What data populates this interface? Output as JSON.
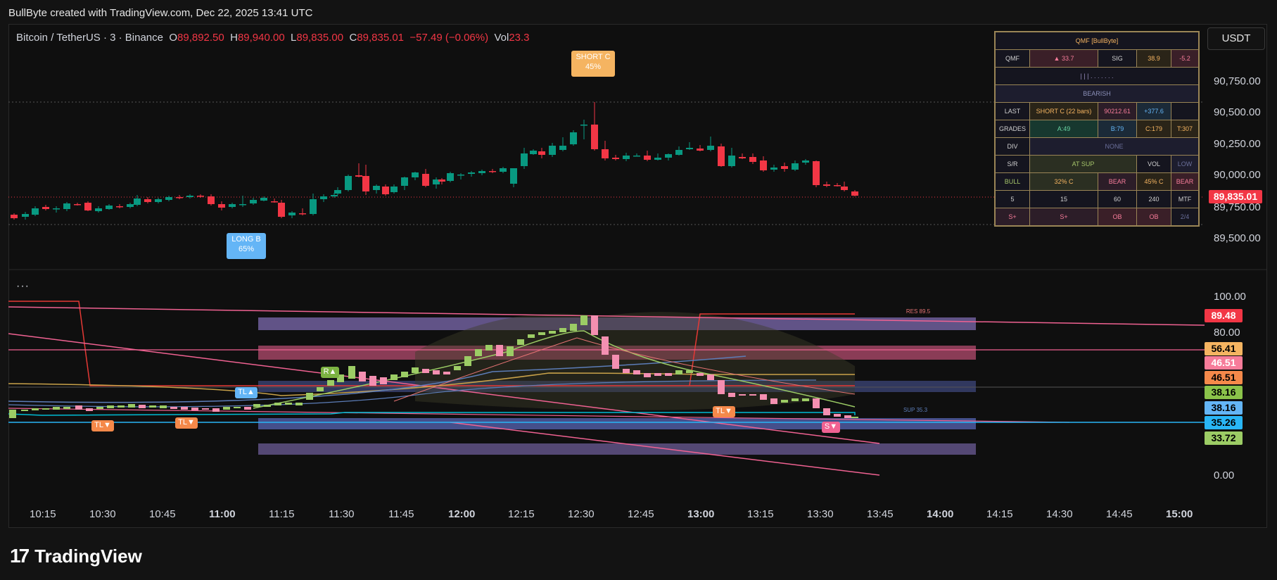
{
  "header": {
    "caption": "BullByte created with TradingView.com, Dec 22, 2025 13:41 UTC"
  },
  "symbol": {
    "name": "Bitcoin / TetherUS · 3 · Binance",
    "open_label": "O",
    "open": "89,892.50",
    "high_label": "H",
    "high": "89,940.00",
    "low_label": "L",
    "low": "89,835.00",
    "close_label": "C",
    "close": "89,835.01",
    "change": "−57.49 (−0.06%)",
    "vol_label": "Vol",
    "vol": "23.3"
  },
  "currency_button": "USDT",
  "indicator_menu": "···",
  "price_axis": [
    "90,750.00",
    "90,500.00",
    "90,250.00",
    "90,000.00",
    "89,750.00",
    "89,500.00"
  ],
  "last_price_tag": "89,835.01",
  "osc_axis": [
    "100.00",
    "80.00",
    "0.00"
  ],
  "osc_tags": [
    {
      "value": "89.48",
      "bg": "#f23645",
      "fg": "#ffffff"
    },
    {
      "value": "56.41",
      "bg": "#f5b461",
      "fg": "#000000"
    },
    {
      "value": "46.51",
      "bg": "#f77c9a",
      "fg": "#ffffff"
    },
    {
      "value": "46.51",
      "bg": "#f5894a",
      "fg": "#000000"
    },
    {
      "value": "38.16",
      "bg": "#8bc34a",
      "fg": "#000000"
    },
    {
      "value": "38.16",
      "bg": "#64b5f6",
      "fg": "#000000"
    },
    {
      "value": "35.26",
      "bg": "#29b6f6",
      "fg": "#000000"
    },
    {
      "value": "33.72",
      "bg": "#9ccc65",
      "fg": "#000000"
    }
  ],
  "time_axis": [
    {
      "label": "10:15",
      "bold": false
    },
    {
      "label": "10:30",
      "bold": false
    },
    {
      "label": "10:45",
      "bold": false
    },
    {
      "label": "11:00",
      "bold": true
    },
    {
      "label": "11:15",
      "bold": false
    },
    {
      "label": "11:30",
      "bold": false
    },
    {
      "label": "11:45",
      "bold": false
    },
    {
      "label": "12:00",
      "bold": true
    },
    {
      "label": "12:15",
      "bold": false
    },
    {
      "label": "12:30",
      "bold": false
    },
    {
      "label": "12:45",
      "bold": false
    },
    {
      "label": "13:00",
      "bold": true
    },
    {
      "label": "13:15",
      "bold": false
    },
    {
      "label": "13:30",
      "bold": false
    },
    {
      "label": "13:45",
      "bold": false
    },
    {
      "label": "14:00",
      "bold": true
    },
    {
      "label": "14:15",
      "bold": false
    },
    {
      "label": "14:30",
      "bold": false
    },
    {
      "label": "14:45",
      "bold": false
    },
    {
      "label": "15:00",
      "bold": true
    }
  ],
  "signals": {
    "short": {
      "line1": "SHORT C",
      "line2": "45%"
    },
    "long": {
      "line1": "LONG B",
      "line2": "65%"
    }
  },
  "osc_labels": {
    "tl_down": "TL▼",
    "tl_up": "TL▲",
    "ra": "R▲",
    "s_down": "S▼",
    "res": "RES 89.5",
    "sup": "SUP 35.3"
  },
  "table": {
    "title": "QMF [BullByte]",
    "qmf_label": "QMF",
    "qmf_value": "▲ 33.7",
    "sig_label": "SIG",
    "sig_value": "38.9",
    "sig_delta": "-5.2",
    "bars": "| | | . . . . . . .",
    "state": "BEARISH",
    "last_label": "LAST",
    "last_signal": "SHORT C (22 bars)",
    "last_price": "90212.61",
    "last_diff": "+377.6",
    "grades_label": "GRADES",
    "grade_a": "A:49",
    "grade_b": "B:79",
    "grade_c": "C:179",
    "grade_t": "T:307",
    "div_label": "DIV",
    "div_value": "NONE",
    "sr_label": "S/R",
    "sr_value": "AT SUP",
    "vol_label": "VOL",
    "vol_value": "LOW",
    "bull_label": "BULL",
    "bull_value": "32% C",
    "bear_label": "BEAR",
    "bear_value": "45% C",
    "bias": "BEAR",
    "tf": [
      "5",
      "15",
      "60",
      "240"
    ],
    "mtf_label": "MTF",
    "tf_state": [
      "S+",
      "S+",
      "OB",
      "OB"
    ],
    "tf_count": "2/4"
  },
  "logo": {
    "mark": "17",
    "text": "TradingView"
  },
  "colors": {
    "up": "#089981",
    "down": "#f23645",
    "bg": "#0f0f0f",
    "table_border": "#9a8556"
  }
}
